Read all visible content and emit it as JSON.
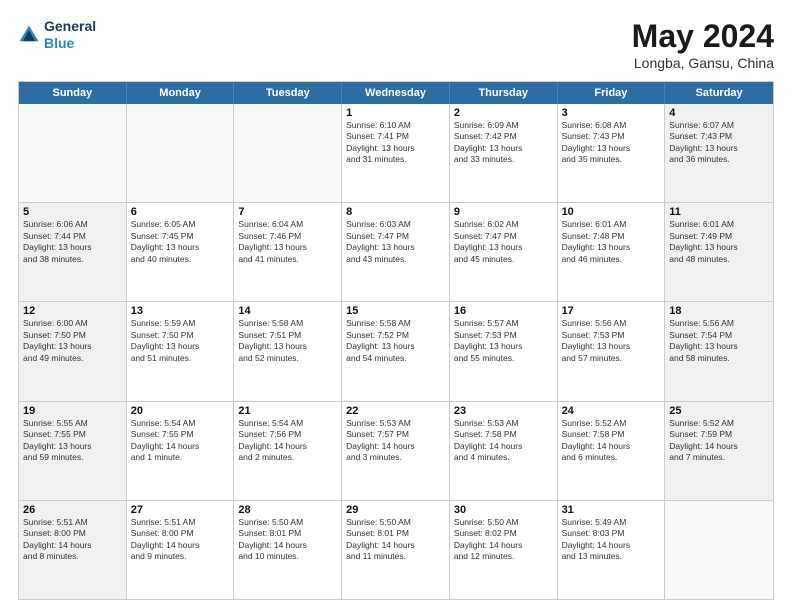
{
  "logo": {
    "line1": "General",
    "line2": "Blue"
  },
  "title": "May 2024",
  "location": "Longba, Gansu, China",
  "days_of_week": [
    "Sunday",
    "Monday",
    "Tuesday",
    "Wednesday",
    "Thursday",
    "Friday",
    "Saturday"
  ],
  "weeks": [
    [
      {
        "day": "",
        "text": "",
        "empty": true
      },
      {
        "day": "",
        "text": "",
        "empty": true
      },
      {
        "day": "",
        "text": "",
        "empty": true
      },
      {
        "day": "1",
        "text": "Sunrise: 6:10 AM\nSunset: 7:41 PM\nDaylight: 13 hours\nand 31 minutes."
      },
      {
        "day": "2",
        "text": "Sunrise: 6:09 AM\nSunset: 7:42 PM\nDaylight: 13 hours\nand 33 minutes."
      },
      {
        "day": "3",
        "text": "Sunrise: 6:08 AM\nSunset: 7:43 PM\nDaylight: 13 hours\nand 35 minutes."
      },
      {
        "day": "4",
        "text": "Sunrise: 6:07 AM\nSunset: 7:43 PM\nDaylight: 13 hours\nand 36 minutes.",
        "shaded": true
      }
    ],
    [
      {
        "day": "5",
        "text": "Sunrise: 6:06 AM\nSunset: 7:44 PM\nDaylight: 13 hours\nand 38 minutes.",
        "shaded": true
      },
      {
        "day": "6",
        "text": "Sunrise: 6:05 AM\nSunset: 7:45 PM\nDaylight: 13 hours\nand 40 minutes."
      },
      {
        "day": "7",
        "text": "Sunrise: 6:04 AM\nSunset: 7:46 PM\nDaylight: 13 hours\nand 41 minutes."
      },
      {
        "day": "8",
        "text": "Sunrise: 6:03 AM\nSunset: 7:47 PM\nDaylight: 13 hours\nand 43 minutes."
      },
      {
        "day": "9",
        "text": "Sunrise: 6:02 AM\nSunset: 7:47 PM\nDaylight: 13 hours\nand 45 minutes."
      },
      {
        "day": "10",
        "text": "Sunrise: 6:01 AM\nSunset: 7:48 PM\nDaylight: 13 hours\nand 46 minutes."
      },
      {
        "day": "11",
        "text": "Sunrise: 6:01 AM\nSunset: 7:49 PM\nDaylight: 13 hours\nand 48 minutes.",
        "shaded": true
      }
    ],
    [
      {
        "day": "12",
        "text": "Sunrise: 6:00 AM\nSunset: 7:50 PM\nDaylight: 13 hours\nand 49 minutes.",
        "shaded": true
      },
      {
        "day": "13",
        "text": "Sunrise: 5:59 AM\nSunset: 7:50 PM\nDaylight: 13 hours\nand 51 minutes."
      },
      {
        "day": "14",
        "text": "Sunrise: 5:58 AM\nSunset: 7:51 PM\nDaylight: 13 hours\nand 52 minutes."
      },
      {
        "day": "15",
        "text": "Sunrise: 5:58 AM\nSunset: 7:52 PM\nDaylight: 13 hours\nand 54 minutes."
      },
      {
        "day": "16",
        "text": "Sunrise: 5:57 AM\nSunset: 7:53 PM\nDaylight: 13 hours\nand 55 minutes."
      },
      {
        "day": "17",
        "text": "Sunrise: 5:56 AM\nSunset: 7:53 PM\nDaylight: 13 hours\nand 57 minutes."
      },
      {
        "day": "18",
        "text": "Sunrise: 5:56 AM\nSunset: 7:54 PM\nDaylight: 13 hours\nand 58 minutes.",
        "shaded": true
      }
    ],
    [
      {
        "day": "19",
        "text": "Sunrise: 5:55 AM\nSunset: 7:55 PM\nDaylight: 13 hours\nand 59 minutes.",
        "shaded": true
      },
      {
        "day": "20",
        "text": "Sunrise: 5:54 AM\nSunset: 7:55 PM\nDaylight: 14 hours\nand 1 minute."
      },
      {
        "day": "21",
        "text": "Sunrise: 5:54 AM\nSunset: 7:56 PM\nDaylight: 14 hours\nand 2 minutes."
      },
      {
        "day": "22",
        "text": "Sunrise: 5:53 AM\nSunset: 7:57 PM\nDaylight: 14 hours\nand 3 minutes."
      },
      {
        "day": "23",
        "text": "Sunrise: 5:53 AM\nSunset: 7:58 PM\nDaylight: 14 hours\nand 4 minutes."
      },
      {
        "day": "24",
        "text": "Sunrise: 5:52 AM\nSunset: 7:58 PM\nDaylight: 14 hours\nand 6 minutes."
      },
      {
        "day": "25",
        "text": "Sunrise: 5:52 AM\nSunset: 7:59 PM\nDaylight: 14 hours\nand 7 minutes.",
        "shaded": true
      }
    ],
    [
      {
        "day": "26",
        "text": "Sunrise: 5:51 AM\nSunset: 8:00 PM\nDaylight: 14 hours\nand 8 minutes.",
        "shaded": true
      },
      {
        "day": "27",
        "text": "Sunrise: 5:51 AM\nSunset: 8:00 PM\nDaylight: 14 hours\nand 9 minutes."
      },
      {
        "day": "28",
        "text": "Sunrise: 5:50 AM\nSunset: 8:01 PM\nDaylight: 14 hours\nand 10 minutes."
      },
      {
        "day": "29",
        "text": "Sunrise: 5:50 AM\nSunset: 8:01 PM\nDaylight: 14 hours\nand 11 minutes."
      },
      {
        "day": "30",
        "text": "Sunrise: 5:50 AM\nSunset: 8:02 PM\nDaylight: 14 hours\nand 12 minutes."
      },
      {
        "day": "31",
        "text": "Sunrise: 5:49 AM\nSunset: 8:03 PM\nDaylight: 14 hours\nand 13 minutes."
      },
      {
        "day": "",
        "text": "",
        "empty": true
      }
    ]
  ]
}
